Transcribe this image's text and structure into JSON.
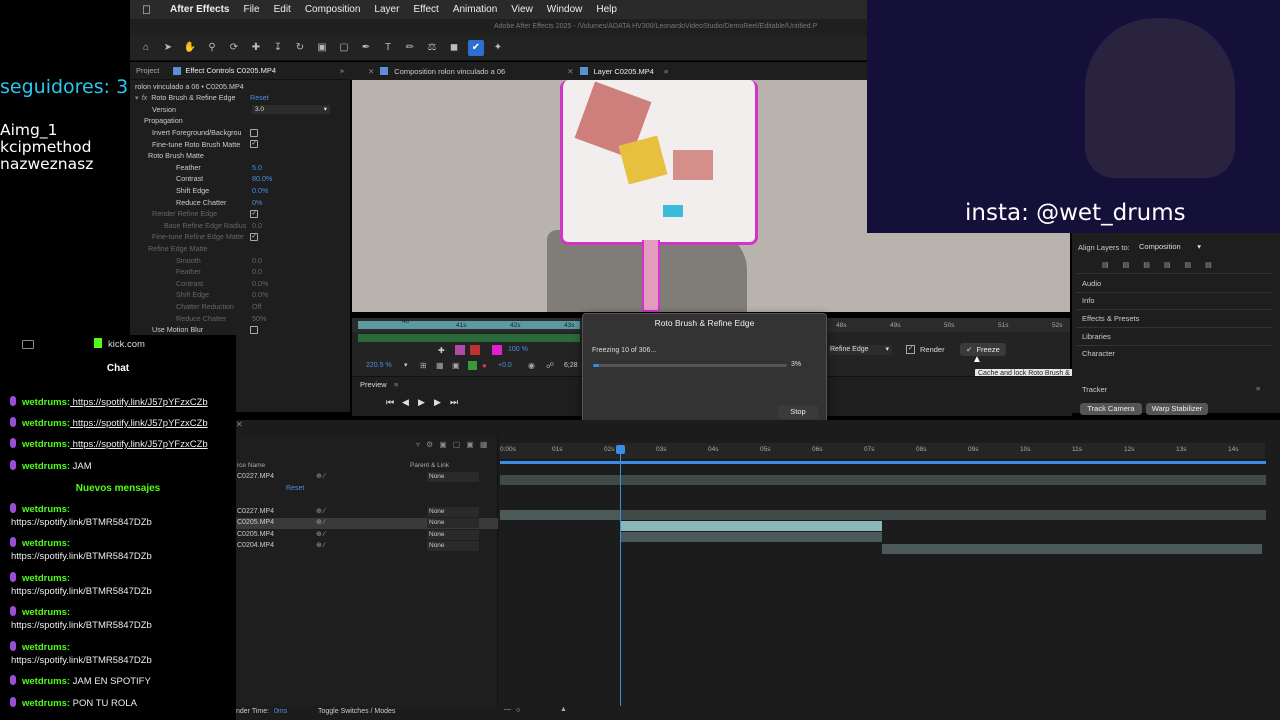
{
  "menubar": {
    "app": "After Effects",
    "items": [
      "File",
      "Edit",
      "Composition",
      "Layer",
      "Effect",
      "Animation",
      "View",
      "Window",
      "Help"
    ],
    "title": "Adobe After Effects 2025 - /Volumes/ADATA HV300/LeonardoVideoStudio/DemoReel/Editable/Untitled.P"
  },
  "stream": {
    "followers": "seguidores: 3",
    "names": [
      "Aimg_1",
      "kcipmethod",
      "nazweznasz"
    ],
    "insta": "insta: @wet_drums",
    "chat_site": "kick.com",
    "chat_title": "Chat",
    "new_messages": "Nuevos mensajes",
    "messages": [
      {
        "user": "wetdrums",
        "text": "https://spotify.link/J57pYFzxCZb",
        "link": true
      },
      {
        "user": "wetdrums",
        "text": "https://spotify.link/J57pYFzxCZb",
        "link": true
      },
      {
        "user": "wetdrums",
        "text": "https://spotify.link/J57pYFzxCZb",
        "link": true
      },
      {
        "user": "wetdrums",
        "text": "JAM",
        "link": false
      }
    ],
    "new_list": [
      {
        "user": "wetdrums",
        "text": "https://spotify.link/BTMR5847DZb"
      },
      {
        "user": "wetdrums",
        "text": "https://spotify.link/BTMR5847DZb"
      },
      {
        "user": "wetdrums",
        "text": "https://spotify.link/BTMR5847DZb"
      },
      {
        "user": "wetdrums",
        "text": "https://spotify.link/BTMR5847DZb"
      },
      {
        "user": "wetdrums",
        "text": "https://spotify.link/BTMR5847DZb"
      }
    ],
    "tail": [
      {
        "user": "wetdrums",
        "text": "JAM EN SPOTIFY"
      },
      {
        "user": "wetdrums",
        "text": "PON TU ROLA"
      }
    ]
  },
  "effects": {
    "tab_project": "Project",
    "tab_effect": "Effect Controls C0205.MP4",
    "layer_path": "rolon vinculado a 06 • C0205.MP4",
    "effect_name": "Roto Brush & Refine Edge",
    "reset": "Reset",
    "version_label": "Version",
    "version_value": "3.0",
    "rows": [
      {
        "label": "Propagation",
        "indent": 14,
        "val": "",
        "dim": false
      },
      {
        "label": "Invert Foreground/Backgrou",
        "indent": 22,
        "val": "",
        "dim": false,
        "check": ""
      },
      {
        "label": "Fine-tune Roto Brush Matte",
        "indent": 22,
        "val": "",
        "dim": false,
        "check": "✓"
      },
      {
        "label": "Roto Brush Matte",
        "indent": 18,
        "val": "",
        "dim": false
      },
      {
        "label": "Feather",
        "indent": 46,
        "val": "5.0",
        "dim": false
      },
      {
        "label": "Contrast",
        "indent": 46,
        "val": "80.0%",
        "dim": false
      },
      {
        "label": "Shift Edge",
        "indent": 46,
        "val": "0.0%",
        "dim": false
      },
      {
        "label": "Reduce Chatter",
        "indent": 46,
        "val": "0%",
        "dim": false
      },
      {
        "label": "Render Refine Edge",
        "indent": 22,
        "val": "",
        "dim": true,
        "check": "✓"
      },
      {
        "label": "Base Refine Edge Radius",
        "indent": 34,
        "val": "0.0",
        "dim": true
      },
      {
        "label": "Fine-tune Refine Edge Matte",
        "indent": 22,
        "val": "",
        "dim": true,
        "check": "✓"
      },
      {
        "label": "Refine Edge Matte",
        "indent": 18,
        "val": "",
        "dim": true
      },
      {
        "label": "Smooth",
        "indent": 46,
        "val": "0.0",
        "dim": true
      },
      {
        "label": "Feather",
        "indent": 46,
        "val": "0.0",
        "dim": true
      },
      {
        "label": "Contrast",
        "indent": 46,
        "val": "0.0%",
        "dim": true
      },
      {
        "label": "Shift Edge",
        "indent": 46,
        "val": "0.0%",
        "dim": true
      },
      {
        "label": "Chatter Reduction",
        "indent": 46,
        "val": "Off",
        "dim": true
      },
      {
        "label": "Reduce Chatter",
        "indent": 46,
        "val": "50%",
        "dim": true
      },
      {
        "label": "Use Motion Blur",
        "indent": 22,
        "val": "",
        "dim": false,
        "check": ""
      }
    ]
  },
  "viewer": {
    "tab_comp": "Composition rolon vinculado a 06",
    "tab_layer": "Layer C0205.MP4",
    "ruler_labels": [
      "40",
      "41s",
      "42s",
      "43s",
      "48s",
      "49s",
      "50s",
      "51s",
      "52s"
    ],
    "zoom": "220.5 %",
    "res": "100 %",
    "offset": "+0.0",
    "view_select": "Refine Edge",
    "render_label": "Render",
    "freeze_label": "Freeze",
    "tooltip": "Cache and lock Roto Brush & Refine Edge propagation",
    "frame_readout": "6;28"
  },
  "dialog": {
    "title": "Roto Brush & Refine Edge",
    "status": "Freezing 10 of 306...",
    "percent": "3%",
    "progress": 0.03,
    "stop": "Stop"
  },
  "preview": {
    "label": "Preview"
  },
  "rightpanel": {
    "align_label": "Align Layers to:",
    "align_value": "Composition",
    "items": [
      "Audio",
      "Info",
      "Effects & Presets",
      "Libraries",
      "Character",
      "Tracker"
    ],
    "track_camera": "Track Camera",
    "warp_stabilizer": "Warp Stabilizer"
  },
  "timeline": {
    "col_source": "rce Name",
    "col_parent": "Parent & Link",
    "ticks": [
      "0:00s",
      "01s",
      "02s",
      "03s",
      "04s",
      "05s",
      "06s",
      "07s",
      "08s",
      "09s",
      "10s",
      "11s",
      "12s",
      "13s",
      "14s"
    ],
    "layers": [
      {
        "name": "C0227.MP4",
        "parent": "None"
      },
      {
        "name": "Reset",
        "parent": ""
      },
      {
        "name": "C0227.MP4",
        "parent": "None"
      },
      {
        "name": "C0205.MP4",
        "parent": "None"
      },
      {
        "name": "C0205.MP4",
        "parent": "None"
      },
      {
        "name": "C0204.MP4",
        "parent": "None"
      }
    ],
    "render_time_label": "nder Time:",
    "render_time_value": "0ms",
    "toggle_label": "Toggle Switches / Modes"
  },
  "colors": {
    "kick_green": "#53fc18",
    "followers_cyan": "#2ac6f0",
    "ae_blue": "#2d6fd0",
    "roto_magenta": "#d234c8"
  }
}
